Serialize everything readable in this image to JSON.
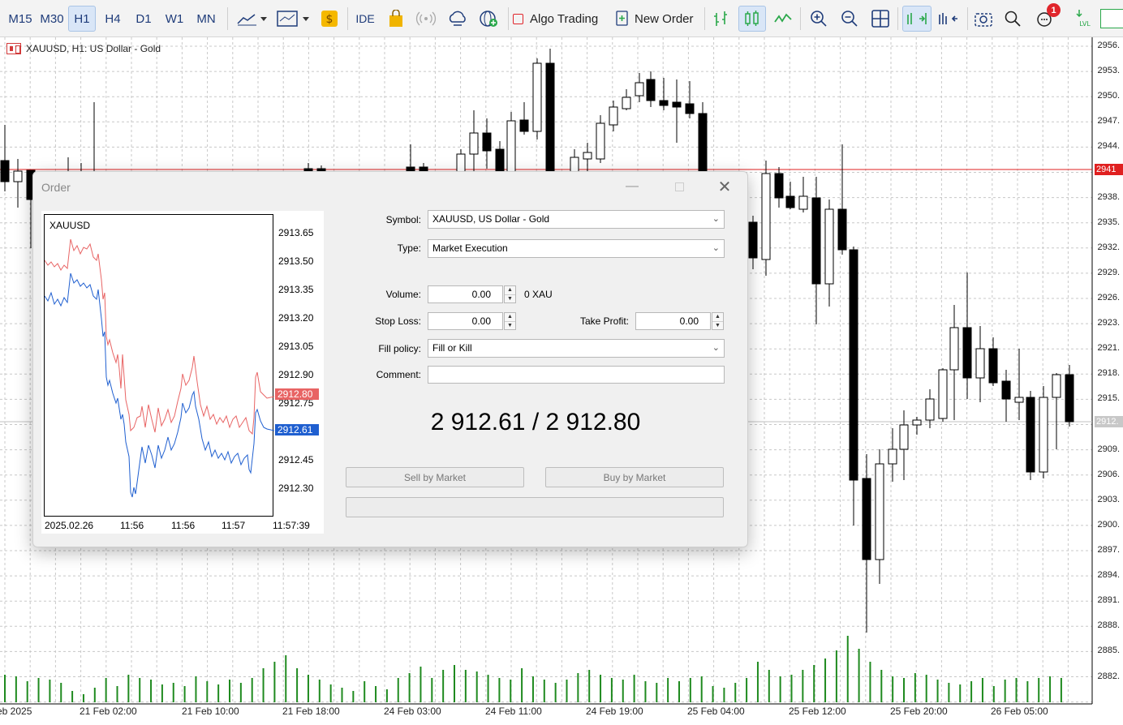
{
  "toolbar": {
    "timeframes": [
      {
        "label": "M15",
        "active": false
      },
      {
        "label": "M30",
        "active": false
      },
      {
        "label": "H1",
        "active": true
      },
      {
        "label": "H4",
        "active": false
      },
      {
        "label": "D1",
        "active": false
      },
      {
        "label": "W1",
        "active": false
      },
      {
        "label": "MN",
        "active": false
      }
    ],
    "ide_label": "IDE",
    "algo_trading_label": "Algo Trading",
    "new_order_label": "New Order",
    "notification_count": "1",
    "accent_color": "#1f3c7a"
  },
  "chart": {
    "title": "XAUUSD, H1:  US Dollar - Gold",
    "price_axis": [
      "2956.",
      "2953.",
      "2950.",
      "2947.",
      "2944.",
      "2941",
      "2938.",
      "2935.",
      "2932.",
      "2929.",
      "2926.",
      "2923.",
      "2921.",
      "2918.",
      "2915.",
      "2912.",
      "2909.",
      "2906.",
      "2903.",
      "2900.",
      "2897.",
      "2894.",
      "2891.",
      "2888.",
      "2885.",
      "2882."
    ],
    "current_price_tag": "2941",
    "bid_price_tag": "2912.",
    "time_axis": [
      "eb 2025",
      "21 Feb 02:00",
      "21 Feb 10:00",
      "21 Feb 18:00",
      "24 Feb 03:00",
      "24 Feb 11:00",
      "24 Feb 19:00",
      "25 Feb 04:00",
      "25 Feb 12:00",
      "25 Feb 20:00",
      "26 Feb 05:00"
    ],
    "colors": {
      "grid": "#c8c8c8",
      "candle": "#000000",
      "volume": "#1f8a1f",
      "ask_line": "#e02020",
      "bid_line": "#c0c0c0"
    }
  },
  "order_dialog": {
    "title": "Order",
    "tick_chart": {
      "symbol": "XAUUSD",
      "prices": [
        "2913.65",
        "2913.50",
        "2913.35",
        "2913.20",
        "2913.05",
        "2912.90",
        "2912.75",
        "2912.45",
        "2912.30"
      ],
      "ask_tag": "2912.80",
      "bid_tag": "2912.61",
      "times": [
        "2025.02.26",
        "11:56",
        "11:56",
        "11:57",
        "11:57:39"
      ],
      "ask_color": "#e86464",
      "bid_color": "#1f5fd0"
    },
    "symbol_label": "Symbol:",
    "symbol_value": "XAUUSD, US Dollar - Gold",
    "type_label": "Type:",
    "type_value": "Market Execution",
    "volume_label": "Volume:",
    "volume_value": "0.00",
    "volume_unit": "0 XAU",
    "stop_loss_label": "Stop Loss:",
    "stop_loss_value": "0.00",
    "take_profit_label": "Take Profit:",
    "take_profit_value": "0.00",
    "fill_policy_label": "Fill policy:",
    "fill_policy_value": "Fill or Kill",
    "comment_label": "Comment:",
    "comment_value": "",
    "quote": "2 912.61 / 2 912.80",
    "sell_label": "Sell by Market",
    "buy_label": "Buy by Market"
  }
}
